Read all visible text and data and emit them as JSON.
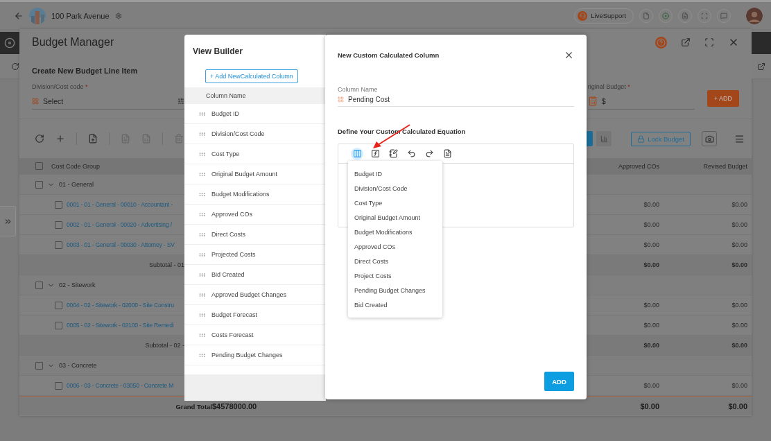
{
  "top_bar": {
    "project": "100 Park Avenue",
    "support": "LiveSupport"
  },
  "budget_manager": {
    "title": "Budget Manager",
    "form": {
      "title": "Create New Budget Line Item",
      "required_mark": "*",
      "division_label": "Division/Cost code",
      "division_placeholder": "Select",
      "budget_label": "riginal Budget",
      "budget_value": "$",
      "add_button": "+ ADD"
    },
    "toolbar": [
      {
        "kind": "refresh",
        "disabled": false
      },
      {
        "kind": "add",
        "disabled": false
      },
      {
        "kind": "file",
        "disabled": false
      },
      {
        "kind": "pdf",
        "disabled": true
      },
      {
        "kind": "sheet",
        "disabled": true
      },
      {
        "kind": "delete",
        "disabled": true
      }
    ],
    "lock_button": "Lock Budget",
    "header_checked": false,
    "columns": [
      "Cost Code Group",
      "Approved COs",
      "Revised Budget"
    ],
    "rows": [
      {
        "kind": "group",
        "label": "01 - General",
        "expanded": true,
        "checked": false
      },
      {
        "kind": "item",
        "label": "0001 - 01 - General - 00010 - Accountant -",
        "checked": false,
        "approved_cos": "$0.00",
        "revised_budget": "$0.00"
      },
      {
        "kind": "item",
        "label": "0002 - 01 - General - 00020 - Advertising /",
        "checked": false,
        "approved_cos": "$0.00",
        "revised_budget": "$0.00"
      },
      {
        "kind": "item",
        "label": "0003 - 01 - General - 00030 - Attorney - SV",
        "checked": false,
        "approved_cos": "$0.00",
        "revised_budget": "$0.00"
      },
      {
        "kind": "subtotal",
        "label": "Subtotal - 01",
        "approved_cos": "$0.00",
        "revised_budget": "$0.00"
      },
      {
        "kind": "group",
        "label": "02 - Sitework",
        "expanded": true,
        "checked": false
      },
      {
        "kind": "item",
        "label": "0004 - 02 - Sitework - 02000 - Site Constru",
        "checked": false,
        "approved_cos": "$0.00",
        "revised_budget": "$0.00"
      },
      {
        "kind": "item",
        "label": "0005 - 02 - Sitework - 02100 - Site Remedi",
        "checked": false,
        "approved_cos": "$0.00",
        "revised_budget": "$0.00"
      },
      {
        "kind": "subtotal",
        "label": "Subtotal - 02 -",
        "approved_cos": "$0.00",
        "revised_budget": "$0.00"
      },
      {
        "kind": "group",
        "label": "03 - Concrete",
        "expanded": true,
        "checked": false
      },
      {
        "kind": "item",
        "label": "0006 - 03 - Concrete - 03050 - Concrete M",
        "checked": false,
        "approved_cos": "$0.00",
        "revised_budget": "$0.00"
      }
    ],
    "grand_total": {
      "label": "Grand Total",
      "amount": "$4578000.00",
      "approved_cos": "$0.00",
      "revised_budget": "$0.00"
    }
  },
  "view_builder": {
    "title": "View Builder",
    "add_button": "+ Add NewCalculated Column",
    "column_header": "Column Name",
    "columns": [
      "Budget ID",
      "Division/Cost Code",
      "Cost Type",
      "Original Budget Amount",
      "Budget Modifications",
      "Approved COs",
      "Direct Costs",
      "Projected Costs",
      "Bid Created",
      "Approved Budget Changes",
      "Budget Forecast",
      "Costs Forecast",
      "Pending Budget Changes"
    ]
  },
  "dialog": {
    "title": "New Custom Calculated Column",
    "name_label": "Column Name",
    "name_value": "Pending Cost",
    "equation_label": "Define Your Custom Calculated Equation",
    "tools": [
      {
        "kind": "columns",
        "selected": true
      },
      {
        "kind": "function",
        "selected": false
      },
      {
        "kind": "notes",
        "selected": false
      },
      {
        "kind": "undo",
        "selected": false
      },
      {
        "kind": "redo",
        "selected": false
      },
      {
        "kind": "document",
        "selected": false
      }
    ],
    "menu": [
      "Budget ID",
      "Division/Cost Code",
      "Cost Type",
      "Original Budget Amount",
      "Budget Modifications",
      "Approved COs",
      "Direct Costs",
      "Project Costs",
      "Pending Budget Changes",
      "Bid Created"
    ],
    "add_button": "ADD"
  }
}
